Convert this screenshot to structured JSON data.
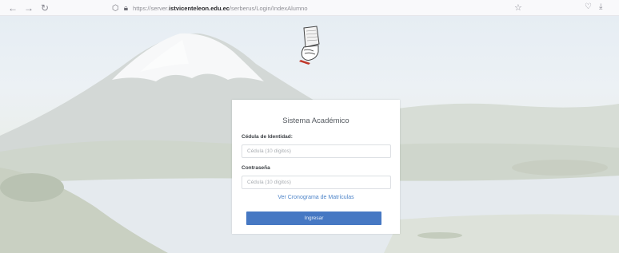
{
  "browser": {
    "back_icon": "arrow-left-icon",
    "forward_icon": "arrow-right-icon",
    "reload_icon": "reload-icon",
    "url_prefix": "https://server.",
    "url_domain": "istvicenteleon.edu.ec",
    "url_path": "/serberus/Login/IndexAlumno",
    "bookmark_icon": "star-icon",
    "pocket_icon": "pocket-icon",
    "download_icon": "download-icon"
  },
  "login": {
    "title": "Sistema Académico",
    "id_label": "Cédula de Identidad:",
    "id_placeholder": "Cédula (10 dígitos)",
    "password_label": "Contraseña",
    "password_placeholder": "Cédula (10 dígitos)",
    "schedule_link": "Ver Cronograma de Matrículas",
    "submit_label": "Ingresar"
  },
  "colors": {
    "accent": "#4678c3",
    "link": "#4f85c9"
  }
}
